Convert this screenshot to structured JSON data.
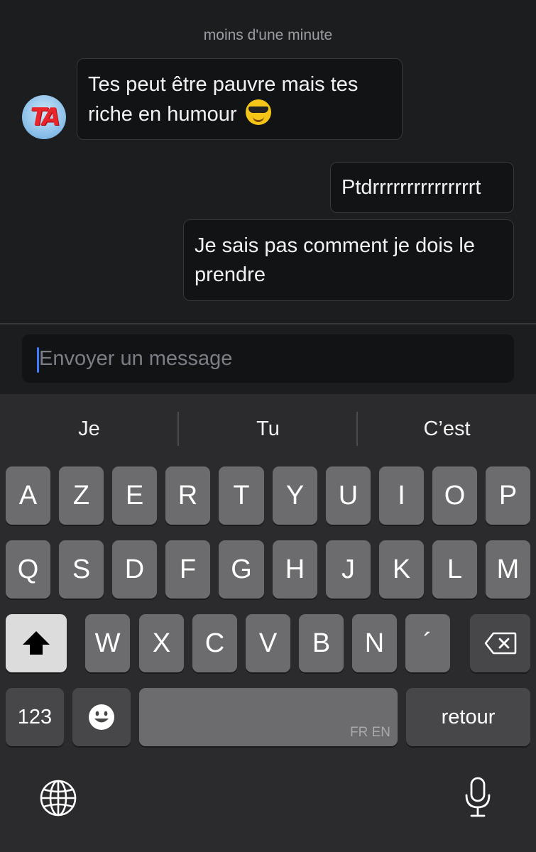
{
  "chat": {
    "timestamp": "moins d'une minute",
    "messages": [
      {
        "from": "other",
        "text": "Tes peut être pauvre mais tes riche en humour",
        "emoji": "smiling-face-with-sunglasses"
      },
      {
        "from": "me",
        "text": "Ptdrrrrrrrrrrrrrrrt"
      },
      {
        "from": "me",
        "text": "Je sais pas comment je dois le prendre"
      }
    ],
    "avatar_text": "TA"
  },
  "composer": {
    "placeholder": "Envoyer un message"
  },
  "keyboard": {
    "suggestions": [
      "Je",
      "Tu",
      "C’est"
    ],
    "row1": [
      "A",
      "Z",
      "E",
      "R",
      "T",
      "Y",
      "U",
      "I",
      "O",
      "P"
    ],
    "row2": [
      "Q",
      "S",
      "D",
      "F",
      "G",
      "H",
      "J",
      "K",
      "L",
      "M"
    ],
    "row3": [
      "W",
      "X",
      "C",
      "V",
      "B",
      "N",
      "´"
    ],
    "numbers_label": "123",
    "space_lang": "FR EN",
    "return_label": "retour",
    "icons": [
      "shift-icon",
      "backspace-icon",
      "emoji-icon",
      "globe-icon",
      "microphone-icon"
    ]
  }
}
